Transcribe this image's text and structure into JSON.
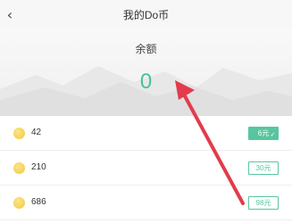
{
  "header": {
    "back_icon": "chevron-left-icon",
    "title": "我的Do币"
  },
  "balance": {
    "label": "余额",
    "value": "0"
  },
  "options": [
    {
      "amount": "42",
      "price": "6元",
      "selected": true
    },
    {
      "amount": "210",
      "price": "30元",
      "selected": false
    },
    {
      "amount": "686",
      "price": "98元",
      "selected": false
    }
  ],
  "colors": {
    "accent": "#46c29a",
    "arrow": "#e23c4b",
    "coin": "#f0c93c"
  }
}
